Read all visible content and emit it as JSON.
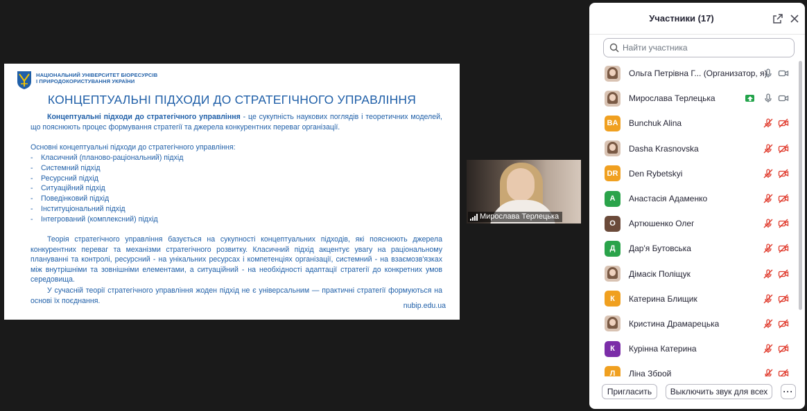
{
  "slide": {
    "university_line1": "НАЦІОНАЛЬНИЙ УНІВЕРСИТЕТ БІОРЕСУРСІВ",
    "university_line2": "І ПРИРОДОКОРИСТУВАННЯ УКРАЇНИ",
    "title": "КОНЦЕПТУАЛЬНІ ПІДХОДИ ДО СТРАТЕГІЧНОГО УПРАВЛІННЯ",
    "p1_bold": "Концептуальні підходи до стратегічного управління",
    "p1_rest": " - це сукупність наукових поглядів і теоретичних моделей, що пояснюють процес формування стратегії та джерела конкурентних переваг організації.",
    "list_title": "Основні концептуальні підходи до стратегічного управління:",
    "approaches": [
      "Класичний (планово-раціональний) підхід",
      "Системний підхід",
      "Ресурсний підхід",
      "Ситуаційний підхід",
      "Поведінковий підхід",
      "Інституціональний підхід",
      "Інтегрований (комплексний) підхід"
    ],
    "p2": "Теорія стратегічного управління базується на сукупності концептуальних підходів, які пояснюють джерела конкурентних переваг та механізми стратегічного розвитку. Класичний підхід акцентує увагу на раціональному плануванні та контролі, ресурсний - на унікальних ресурсах і компетенціях організації, системний - на взаємозв'язках між внутрішніми та зовнішніми елементами, а ситуаційний - на необхідності адаптації стратегії до конкретних умов середовища.",
    "p3": "У сучасній теорії стратегічного управління жоден підхід не є універсальним — практичні стратегії формуються на основі їх поєднання.",
    "website": "nubip.edu.ua"
  },
  "video": {
    "name": "Мирослава Терлецька"
  },
  "panel": {
    "title": "Участники (17)",
    "search_placeholder": "Найти участника",
    "invite_label": "Пригласить",
    "mute_all_label": "Выключить звук для всех",
    "more_label": "···",
    "participants": [
      {
        "name": "Ольга Петрівна Г...  (Организатор, я)",
        "initials": "",
        "color": "",
        "photo": true,
        "muted": false
      },
      {
        "name": "Мирослава Терлецька",
        "initials": "",
        "color": "",
        "photo": true,
        "muted": false,
        "sharing": true
      },
      {
        "name": "Bunchuk Alina",
        "initials": "BA",
        "color": "#f0a020",
        "photo": false,
        "muted": true
      },
      {
        "name": "Dasha Krasnovska",
        "initials": "",
        "color": "",
        "photo": true,
        "muted": true
      },
      {
        "name": "Den Rybetskyi",
        "initials": "DR",
        "color": "#f0a020",
        "photo": false,
        "muted": true
      },
      {
        "name": "Анастасія Адаменко",
        "initials": "А",
        "color": "#2aa34a",
        "photo": false,
        "muted": true
      },
      {
        "name": "Артюшенко Олег",
        "initials": "О",
        "color": "#6b4a3a",
        "photo": false,
        "muted": true
      },
      {
        "name": "Дар'я Бутовська",
        "initials": "Д",
        "color": "#2aa34a",
        "photo": false,
        "muted": true
      },
      {
        "name": "Дімасік Поліщук",
        "initials": "",
        "color": "",
        "photo": true,
        "muted": true
      },
      {
        "name": "Катерина Блищик",
        "initials": "К",
        "color": "#f0a020",
        "photo": false,
        "muted": true
      },
      {
        "name": "Кристина Драмарецька",
        "initials": "",
        "color": "",
        "photo": true,
        "muted": true
      },
      {
        "name": "Курінна Катерина",
        "initials": "К",
        "color": "#7b2da8",
        "photo": false,
        "muted": true
      },
      {
        "name": "Ліна Збрoй",
        "initials": "Л",
        "color": "#f0a020",
        "photo": false,
        "muted": true
      }
    ]
  },
  "colors": {
    "slide_text": "#1f5fa8",
    "muted_icon": "#e0392b",
    "share_badge": "#22a34a"
  }
}
